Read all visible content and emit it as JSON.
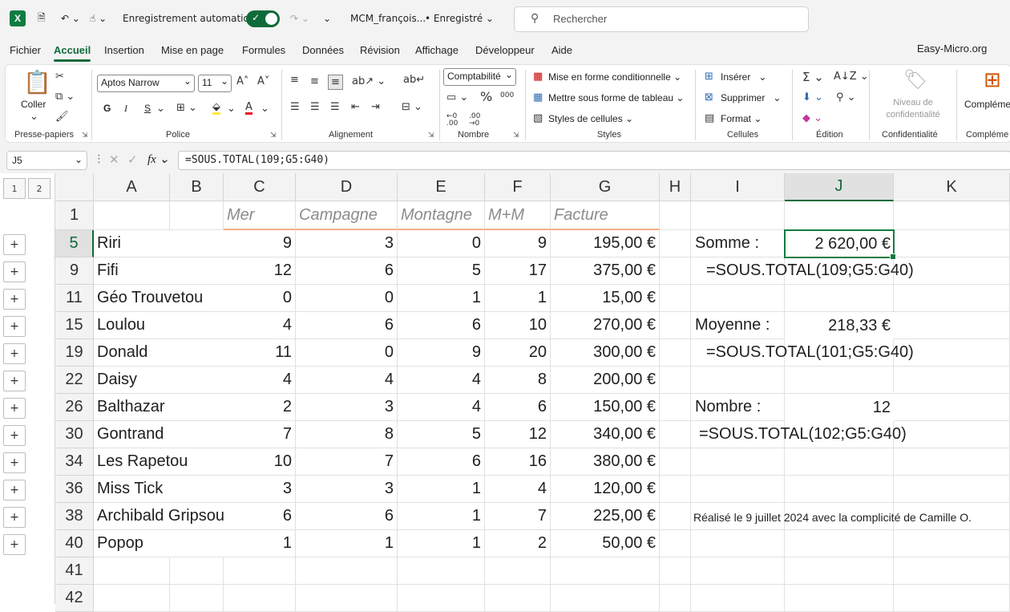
{
  "titlebar": {
    "autosave_label": "Enregistrement automatique",
    "filename": "MCM_françois...",
    "saved_status": "• Enregistré",
    "search_placeholder": "Rechercher"
  },
  "menu": {
    "items": [
      "Fichier",
      "Accueil",
      "Insertion",
      "Mise en page",
      "Formules",
      "Données",
      "Révision",
      "Affichage",
      "Développeur",
      "Aide"
    ],
    "active": "Accueil",
    "brand": "Easy-Micro.org"
  },
  "ribbon": {
    "clipboard": {
      "paste": "Coller",
      "label": "Presse-papiers"
    },
    "font": {
      "name": "Aptos Narrow",
      "size": "11",
      "bold": "G",
      "italic": "I",
      "underline": "S",
      "label": "Police"
    },
    "alignment": {
      "label": "Alignement"
    },
    "number": {
      "format": "Comptabilité",
      "label": "Nombre"
    },
    "styles": {
      "conditional": "Mise en forme conditionnelle",
      "table": "Mettre sous forme de tableau",
      "cell_styles": "Styles de cellules",
      "label": "Styles"
    },
    "cells": {
      "insert": "Insérer",
      "delete": "Supprimer",
      "format": "Format",
      "label": "Cellules"
    },
    "editing": {
      "label": "Édition"
    },
    "sensitivity": {
      "button": "Niveau de confidentialité",
      "label": "Confidentialité"
    },
    "addins": {
      "button": "Compléme",
      "label": "Compléme"
    }
  },
  "formula_bar": {
    "name_box": "J5",
    "formula": "=SOUS.TOTAL(109;G5:G40)"
  },
  "outline": {
    "levels": [
      "1",
      "2"
    ]
  },
  "sheet": {
    "columns": [
      "A",
      "B",
      "C",
      "D",
      "E",
      "F",
      "G",
      "H",
      "I",
      "J",
      "K"
    ],
    "selected_column": "J",
    "header_row": {
      "row": "1",
      "cells": [
        "Mer",
        "Campagne",
        "Montagne",
        "M+M",
        "Facture"
      ]
    },
    "rows": [
      {
        "row": "5",
        "name": "Riri",
        "mer": "9",
        "campagne": "3",
        "montagne": "0",
        "mm": "9",
        "facture": "195,00 €"
      },
      {
        "row": "9",
        "name": "Fifi",
        "mer": "12",
        "campagne": "6",
        "montagne": "5",
        "mm": "17",
        "facture": "375,00 €"
      },
      {
        "row": "11",
        "name": "Géo Trouvetou",
        "mer": "0",
        "campagne": "0",
        "montagne": "1",
        "mm": "1",
        "facture": "15,00 €"
      },
      {
        "row": "15",
        "name": "Loulou",
        "mer": "4",
        "campagne": "6",
        "montagne": "6",
        "mm": "10",
        "facture": "270,00 €"
      },
      {
        "row": "19",
        "name": "Donald",
        "mer": "11",
        "campagne": "0",
        "montagne": "9",
        "mm": "20",
        "facture": "300,00 €"
      },
      {
        "row": "22",
        "name": "Daisy",
        "mer": "4",
        "campagne": "4",
        "montagne": "4",
        "mm": "8",
        "facture": "200,00 €"
      },
      {
        "row": "26",
        "name": "Balthazar",
        "mer": "2",
        "campagne": "3",
        "montagne": "4",
        "mm": "6",
        "facture": "150,00 €"
      },
      {
        "row": "30",
        "name": "Gontrand",
        "mer": "7",
        "campagne": "8",
        "montagne": "5",
        "mm": "12",
        "facture": "340,00 €"
      },
      {
        "row": "34",
        "name": "Les Rapetou",
        "mer": "10",
        "campagne": "7",
        "montagne": "6",
        "mm": "16",
        "facture": "380,00 €"
      },
      {
        "row": "36",
        "name": "Miss Tick",
        "mer": "3",
        "campagne": "3",
        "montagne": "1",
        "mm": "4",
        "facture": "120,00 €"
      },
      {
        "row": "38",
        "name": "Archibald Gripsou",
        "mer": "6",
        "campagne": "6",
        "montagne": "1",
        "mm": "7",
        "facture": "225,00 €"
      },
      {
        "row": "40",
        "name": "Popop",
        "mer": "1",
        "campagne": "1",
        "montagne": "1",
        "mm": "2",
        "facture": "50,00 €"
      }
    ],
    "extra_rows": [
      "41",
      "42"
    ],
    "summary": {
      "somme_label": "Somme :",
      "somme_value": "2 620,00 €",
      "somme_formula": "=SOUS.TOTAL(109;G5:G40)",
      "moyenne_label": "Moyenne :",
      "moyenne_value": "218,33 €",
      "moyenne_formula": "=SOUS.TOTAL(101;G5:G40)",
      "nombre_label": "Nombre :",
      "nombre_value": "12",
      "nombre_formula": "=SOUS.TOTAL(102;G5:G40)",
      "credit": "Réalisé le 9 juillet 2024 avec la complicité de Camille O."
    }
  },
  "colors": {
    "accent": "#0f6b3a",
    "excel_green": "#107c41",
    "header_underline": "#f4b183"
  }
}
